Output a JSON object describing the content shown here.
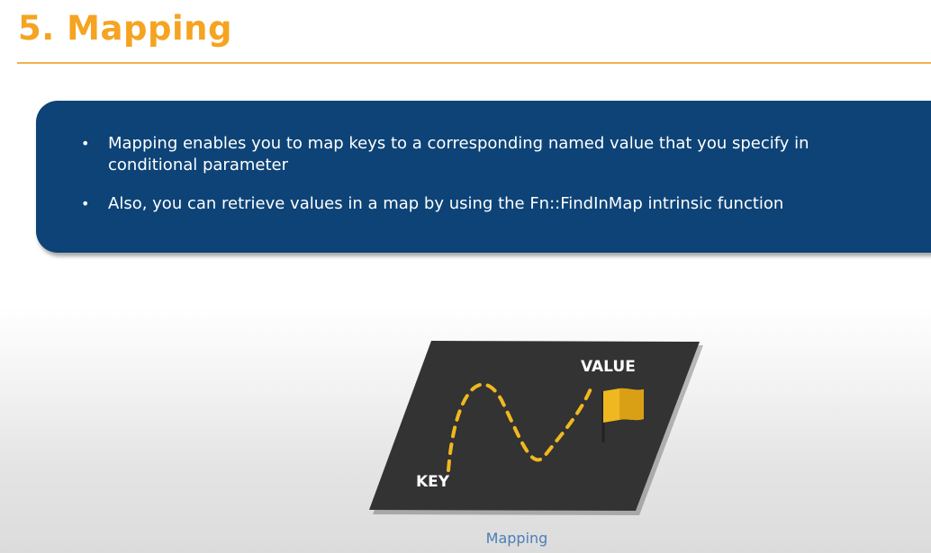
{
  "slide": {
    "title": "5. Mapping"
  },
  "content": {
    "bullets": [
      "Mapping enables you to map keys to a corresponding named value that you specify in conditional parameter",
      "Also, you can retrieve values in a map by using the Fn::FindInMap intrinsic function"
    ]
  },
  "figure": {
    "key_label": "KEY",
    "value_label": "VALUE",
    "caption": "Mapping",
    "icons": [
      "dashed-path-icon",
      "flag-icon"
    ]
  },
  "colors": {
    "title": "#f5a422",
    "rule": "#f3b24a",
    "box": "#0d4377",
    "panel": "#333333",
    "accent": "#f0b820",
    "caption": "#4a7fb5"
  }
}
